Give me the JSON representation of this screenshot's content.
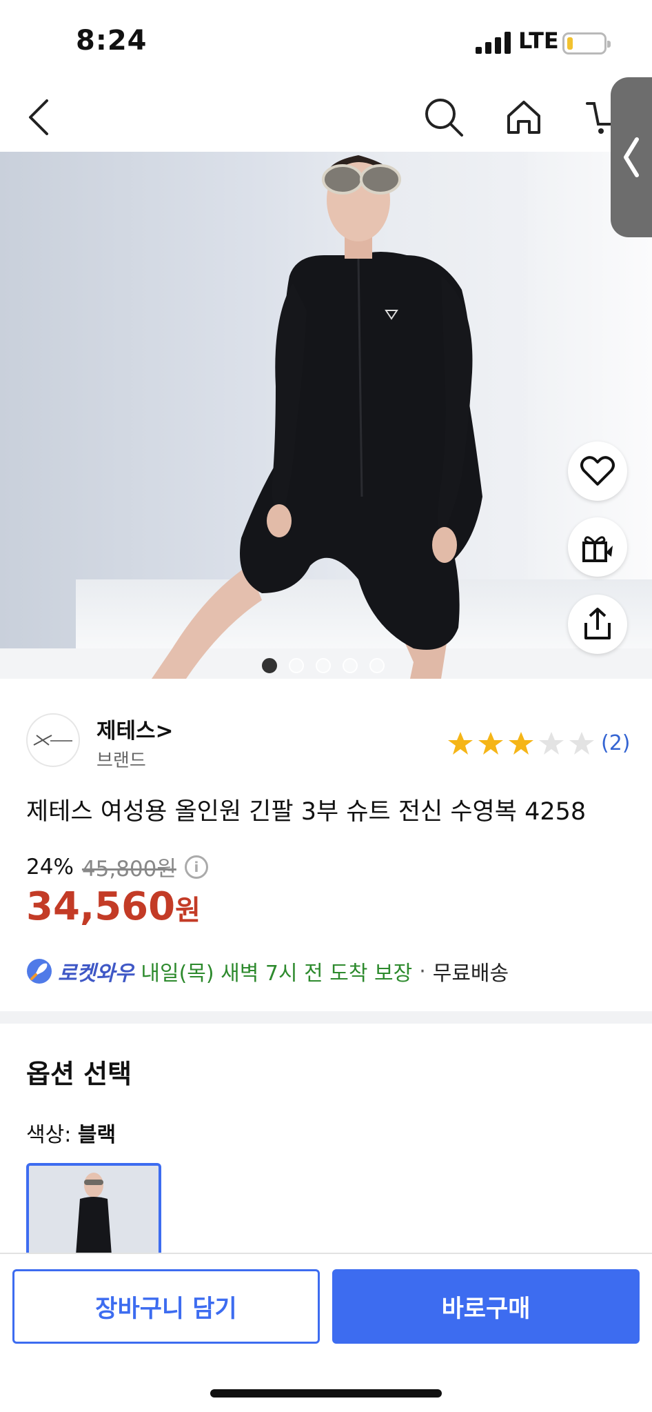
{
  "status_bar": {
    "time": "8:24",
    "network": "LTE"
  },
  "nav": {
    "back_icon": "chevron-left-icon",
    "search_icon": "search-icon",
    "home_icon": "home-icon",
    "cart_icon": "cart-icon"
  },
  "hero": {
    "image_count": 5,
    "active_index": 0
  },
  "brand": {
    "name": "제테스>",
    "subtitle": "브랜드"
  },
  "rating": {
    "stars": 3,
    "max": 5,
    "count_label": "(2)"
  },
  "product": {
    "title": "제테스 여성용 올인원 긴팔 3부 슈트 전신 수영복 4258"
  },
  "pricing": {
    "discount": "24%",
    "original_price": "45,800원",
    "price": "34,560",
    "price_unit": "원",
    "info_icon": "i"
  },
  "delivery": {
    "brand": "로켓와우",
    "eta": "내일(목) 새벽 7시 전 도착 보장",
    "separator": "·",
    "shipping": "무료배송"
  },
  "options": {
    "title": "옵션 선택",
    "color_label": "색상: ",
    "color_value": "블랙"
  },
  "actions": {
    "cart_label": "장바구니 담기",
    "buy_label": "바로구매"
  },
  "colors": {
    "accent": "#3d6cf0",
    "price_red": "#c33b26",
    "delivery_green": "#2d8a2d",
    "star_gold": "#f5b517"
  }
}
